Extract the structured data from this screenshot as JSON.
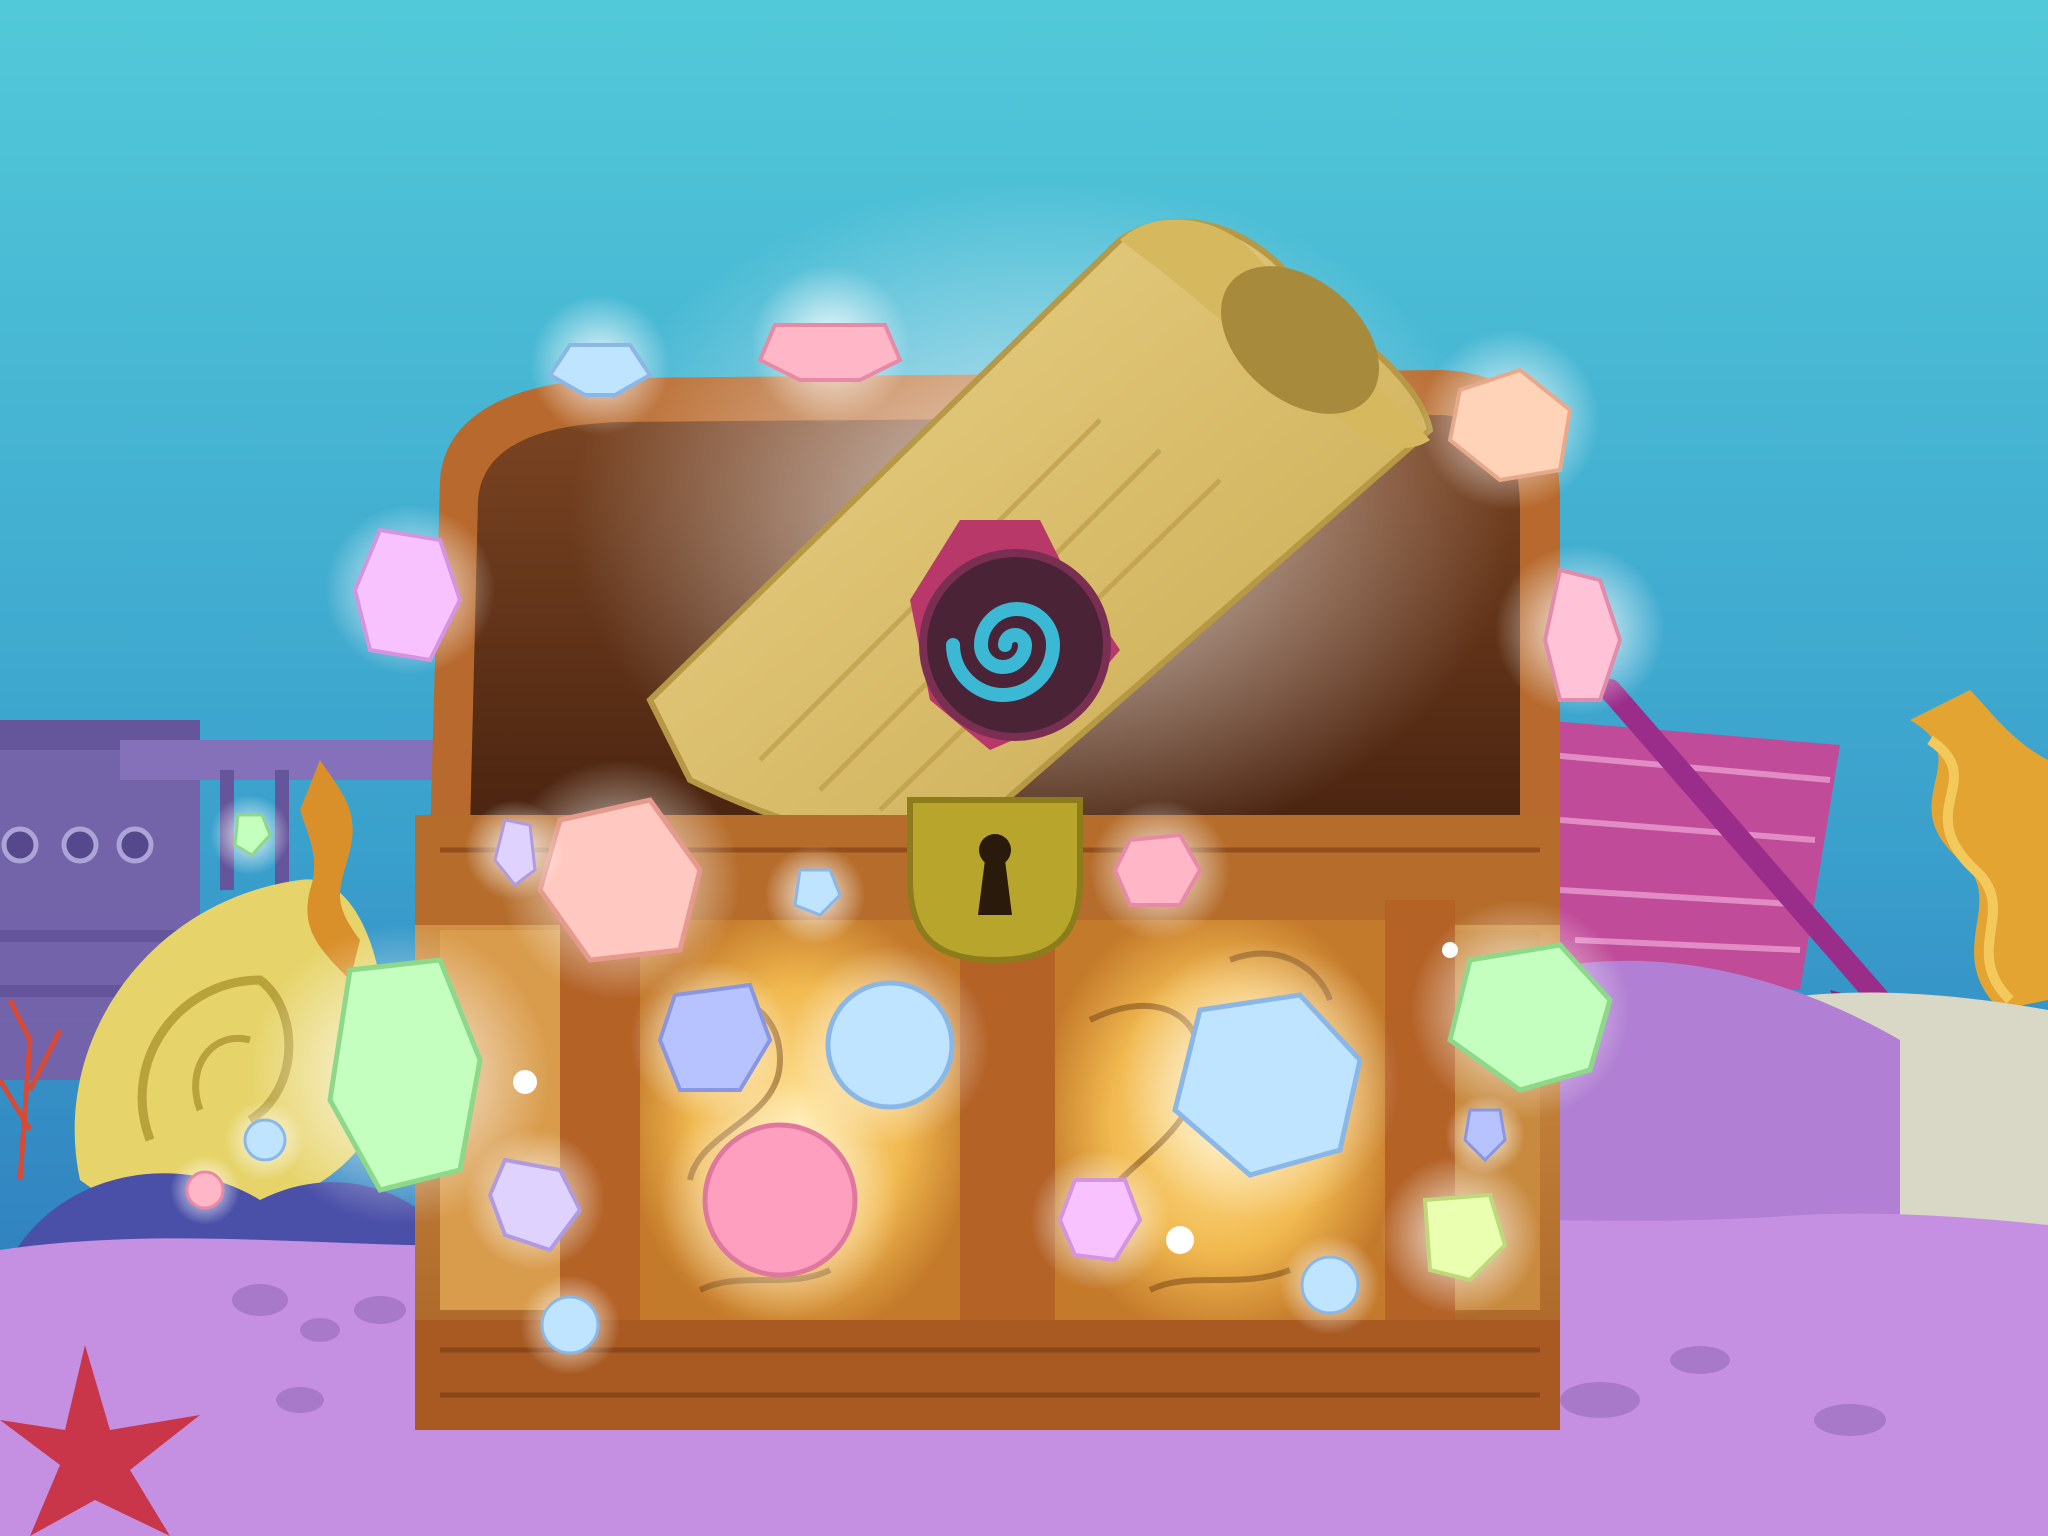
{
  "scene": {
    "setting": "underwater",
    "main_object": "treasure-chest",
    "contents": [
      "scroll-with-spiral-seal",
      "gems"
    ]
  },
  "colors": {
    "water_top": "#4cc5d6",
    "water_bottom": "#2f7fbf",
    "sand": "#c58fe0",
    "chest_wood": "#b86a2e",
    "chest_lid_inner": "#6e3a1c",
    "scroll": "#dcc06a",
    "seal_ribbon": "#b8386a",
    "seal_spiral": "#3ab8d4",
    "lock": "#b7a52c"
  },
  "icons": [
    "keyhole-icon",
    "spiral-seal-icon",
    "starfish-icon",
    "shovel-icon"
  ],
  "gem_palette": [
    "#ffb7c8",
    "#bfe4ff",
    "#c5ffc0",
    "#ffd3b8",
    "#f7c2ff",
    "#b7c3ff"
  ]
}
